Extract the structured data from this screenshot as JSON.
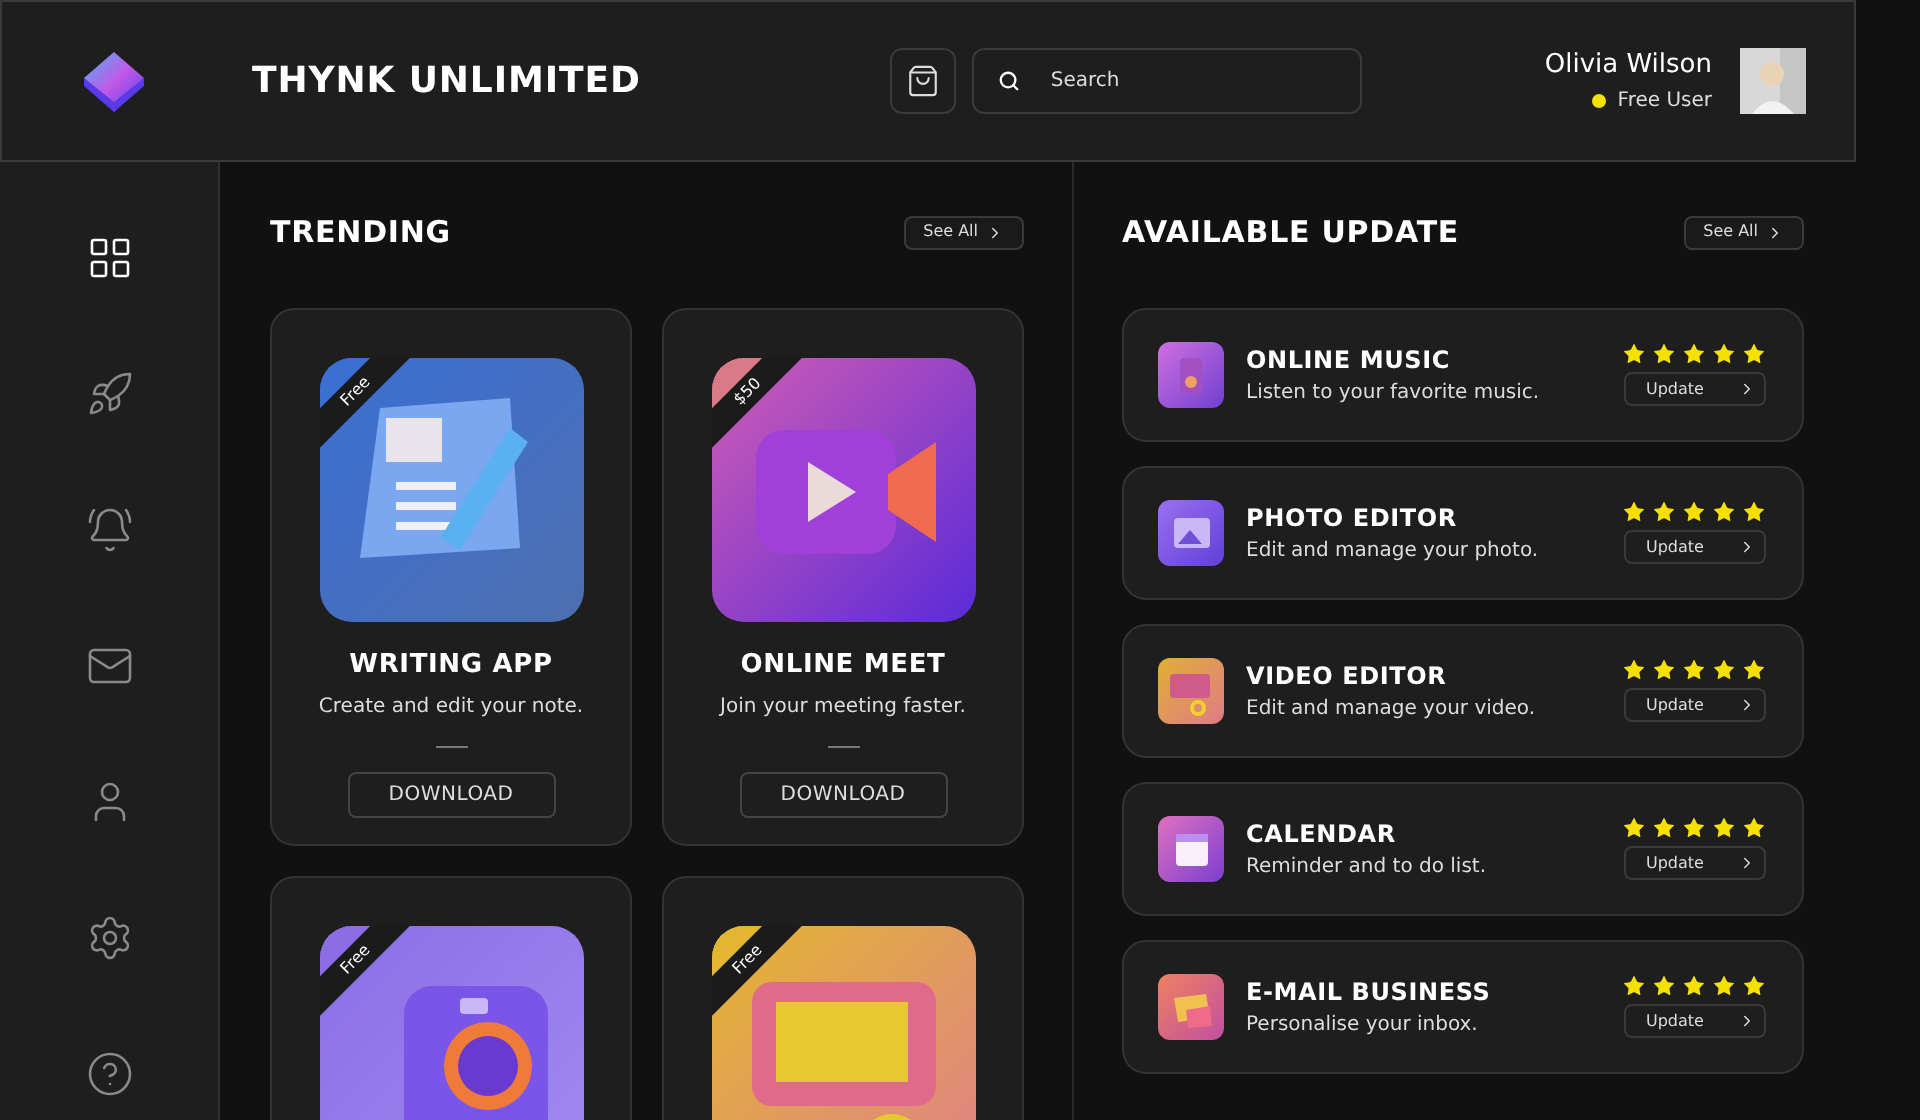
{
  "header": {
    "title": "THYNK UNLIMITED",
    "search": {
      "placeholder": "Search"
    },
    "user": {
      "name": "Olivia Wilson",
      "status": "Free User"
    }
  },
  "sidebar": {
    "items": [
      {
        "selected": true
      },
      {
        "selected": false
      },
      {
        "selected": false
      },
      {
        "selected": false
      },
      {
        "selected": false
      },
      {
        "selected": false
      },
      {
        "selected": false
      }
    ]
  },
  "trending": {
    "title": "TRENDING",
    "see_all": "See All",
    "apps": [
      {
        "badge": "Free",
        "color": "#3b6fd4",
        "title": "WRITING APP",
        "description": "Create and edit your note.",
        "button": "DOWNLOAD"
      },
      {
        "badge": "$50",
        "color": "#d97b86",
        "title": "ONLINE MEET",
        "description": "Join your meeting faster.",
        "button": "DOWNLOAD"
      },
      {
        "badge": "Free",
        "color": "#8b6de6"
      },
      {
        "badge": "Free",
        "color": "#e2b631"
      }
    ]
  },
  "updates": {
    "title": "AVAILABLE UPDATE",
    "see_all": "See All",
    "apps": [
      {
        "title": "ONLINE MUSIC",
        "description": "Listen to your favorite music.",
        "stars": 5,
        "button": "Update"
      },
      {
        "title": "PHOTO EDITOR",
        "description": "Edit and manage your photo.",
        "stars": 5,
        "button": "Update"
      },
      {
        "title": "VIDEO EDITOR",
        "description": "Edit and manage your video.",
        "stars": 5,
        "button": "Update"
      },
      {
        "title": "CALENDAR",
        "description": "Reminder and to do list.",
        "stars": 5,
        "button": "Update"
      },
      {
        "title": "E-MAIL BUSINESS",
        "description": "Personalise your inbox.",
        "stars": 5,
        "button": "Update"
      }
    ]
  }
}
